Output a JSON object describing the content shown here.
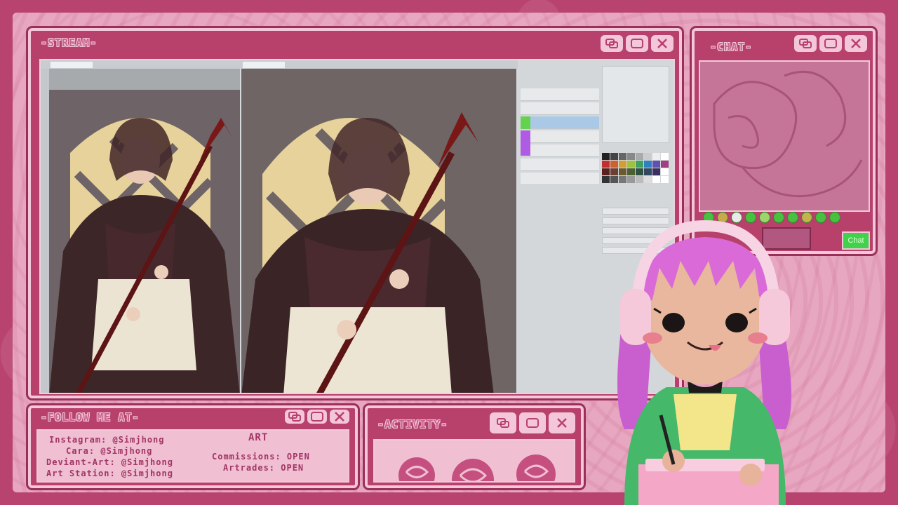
{
  "windows": {
    "stream": {
      "title": "-STREAM-"
    },
    "chat": {
      "title": "-CHAT-",
      "send_label": "Chat"
    },
    "follow": {
      "title": "-FOLLOW ME AT-"
    },
    "activity": {
      "title": "-ACTIVITY-"
    }
  },
  "follow": {
    "heading": "ART",
    "lines": [
      "Instagram: @Simjhong",
      "Cara: @Simjhong",
      "Deviant-Art: @Simjhong",
      "Art Station: @Simjhong"
    ],
    "commissions": "Commissions: OPEN",
    "artrades": "Artrades: OPEN"
  },
  "icons": {
    "restore": "restore-window-icon",
    "maximize": "maximize-icon",
    "close": "close-icon"
  },
  "colors": {
    "frame": "#b9436f",
    "panel": "#e7a7c1",
    "accent": "#3fd24a"
  }
}
